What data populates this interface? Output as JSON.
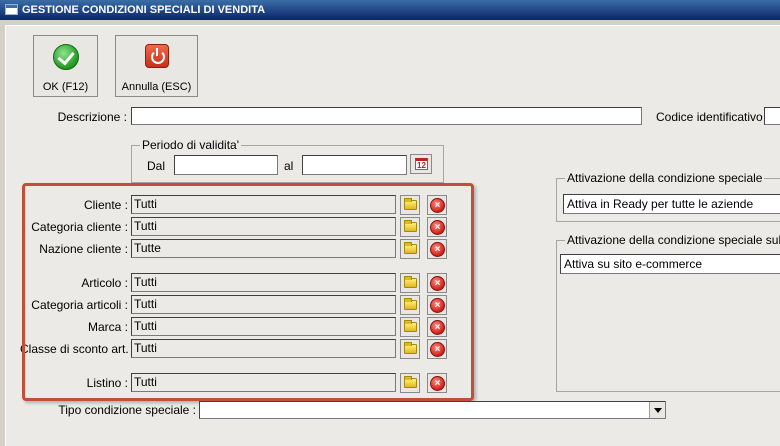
{
  "window": {
    "title": "GESTIONE CONDIZIONI SPECIALI DI VENDITA"
  },
  "toolbar": {
    "ok_label": "OK (F12)",
    "cancel_label": "Annulla (ESC)"
  },
  "form": {
    "descrizione_label": "Descrizione :",
    "descrizione_value": "",
    "codice_label": "Codice identificativo :",
    "codice_value": "",
    "periodo": {
      "title": "Periodo di validita'",
      "dal_label": "Dal",
      "dal_value": "",
      "al_label": "al",
      "al_value": "",
      "calendar_icon": "calendar-icon"
    },
    "filters": [
      {
        "label": "Cliente :",
        "value": "Tutti"
      },
      {
        "label": "Categoria cliente :",
        "value": "Tutti"
      },
      {
        "label": "Nazione cliente :",
        "value": "Tutte"
      },
      {
        "label": "Articolo :",
        "value": "Tutti"
      },
      {
        "label": "Categoria articoli :",
        "value": "Tutti"
      },
      {
        "label": "Marca :",
        "value": "Tutti"
      },
      {
        "label": "Classe di sconto art. :",
        "value": "Tutti"
      },
      {
        "label": "Listino :",
        "value": "Tutti"
      }
    ],
    "tipo_label": "Tipo condizione speciale :",
    "tipo_value": ""
  },
  "activation": {
    "title": "Attivazione della condizione speciale",
    "value": "Attiva in Ready per tutte le aziende",
    "site_title": "Attivazione della condizione speciale sul sito e",
    "site_value": "Attiva su sito e-commerce"
  },
  "colors": {
    "highlight": "#c0503a",
    "titlebar": "#0a246a"
  },
  "icons": {
    "ok": "check-icon",
    "cancel": "power-icon",
    "browse": "folder-icon",
    "clear": "delete-icon"
  }
}
